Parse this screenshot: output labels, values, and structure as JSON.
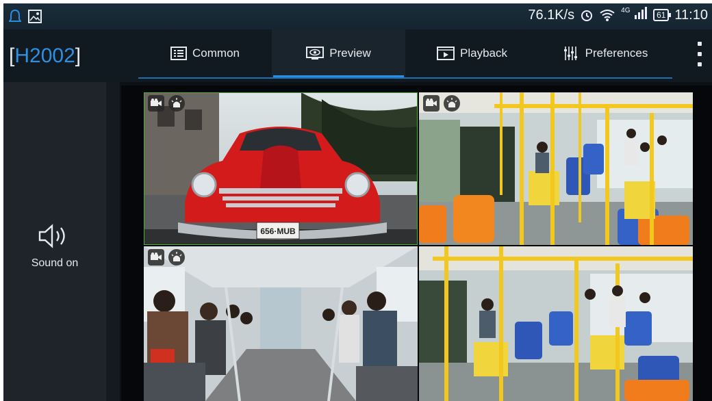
{
  "status_bar": {
    "net_speed": "76.1K/s",
    "network": "4G",
    "battery": "61",
    "time": "11:10"
  },
  "device": {
    "name": "H2002"
  },
  "tabs": [
    {
      "label": "Common",
      "icon": "grid-icon",
      "active": false
    },
    {
      "label": "Preview",
      "icon": "eye-icon",
      "active": true
    },
    {
      "label": "Playback",
      "icon": "film-icon",
      "active": false
    },
    {
      "label": "Preferences",
      "icon": "sliders-icon",
      "active": false
    }
  ],
  "sound": {
    "label": "Sound on",
    "icon": "speaker-icon"
  },
  "channels": [
    {
      "scene": "red vintage car",
      "selected": true,
      "overlay_icons": [
        "camera-icon",
        "alarm-icon"
      ]
    },
    {
      "scene": "bus interior, yellow rails",
      "selected": false,
      "overlay_icons": [
        "camera-icon",
        "alarm-icon"
      ]
    },
    {
      "scene": "bus interior, passengers",
      "selected": false,
      "overlay_icons": [
        "camera-icon",
        "alarm-icon"
      ]
    },
    {
      "scene": "bus interior, rear view",
      "selected": false,
      "overlay_icons": []
    }
  ],
  "colors": {
    "accent": "#2a8de0",
    "selected_border": "#4caf3a"
  }
}
